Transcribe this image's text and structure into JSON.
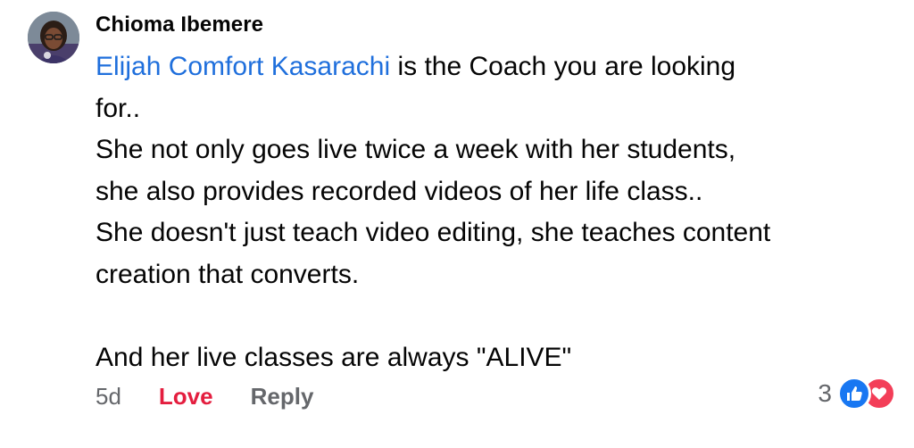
{
  "comment": {
    "author": "Chioma Ibemere",
    "mention": "Elijah Comfort Kasarachi",
    "lines": [
      " is the Coach you are looking",
      "for..",
      "She not only goes live twice a week with her students,",
      "she also provides recorded videos of her life class..",
      "She doesn't just teach video editing, she teaches content",
      "creation that converts.",
      "And her live classes are always \"ALIVE\""
    ]
  },
  "actions": {
    "time": "5d",
    "love_label": "Love",
    "reply_label": "Reply"
  },
  "reactions": {
    "count": "3",
    "icons": [
      "like-icon",
      "heart-icon"
    ],
    "colors": {
      "like": "#1877f2",
      "heart": "#f33e58"
    }
  },
  "colors": {
    "mention": "#1f6fdc",
    "love": "#e41e3f",
    "muted": "#65676b",
    "text": "#050505"
  }
}
